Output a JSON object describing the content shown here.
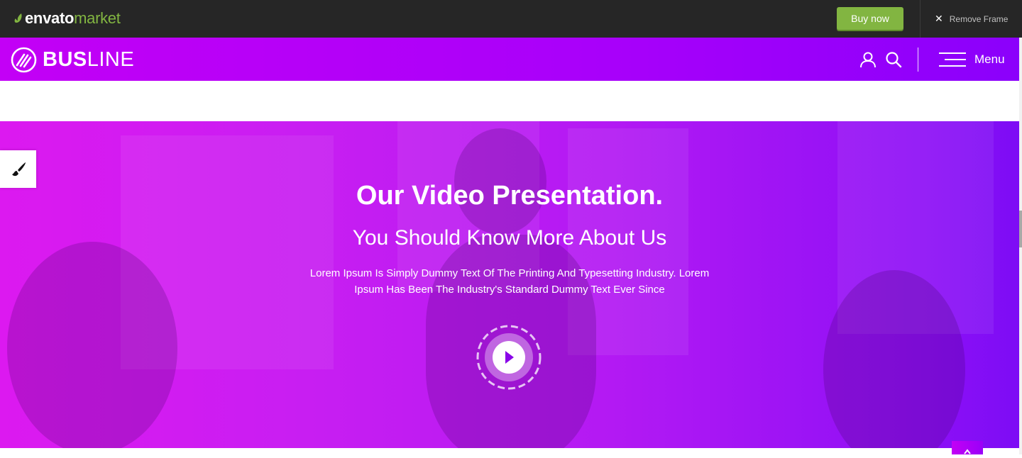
{
  "envato": {
    "logo_word1": "envato",
    "logo_word2": "market",
    "buy_label": "Buy now",
    "remove_label": "Remove Frame",
    "brand_green": "#82b541"
  },
  "header": {
    "logo_bold": "BUS",
    "logo_light": "LINE",
    "menu_label": "Menu",
    "icons": [
      "user-icon",
      "search-icon",
      "hamburger-icon"
    ]
  },
  "hero": {
    "title": "Our Video Presentation.",
    "subtitle": "You Should Know More About Us",
    "description_line1": "Lorem Ipsum Is Simply Dummy Text Of The Printing And Typesetting Industry. Lorem",
    "description_line2": "Ipsum Has Been The Industry's Standard Dummy Text Ever Since",
    "gradient_start": "#dc19f0",
    "gradient_end": "#7d0cf5"
  },
  "widgets": {
    "paint_icon": "paintbrush-icon",
    "play_icon": "play-icon"
  }
}
